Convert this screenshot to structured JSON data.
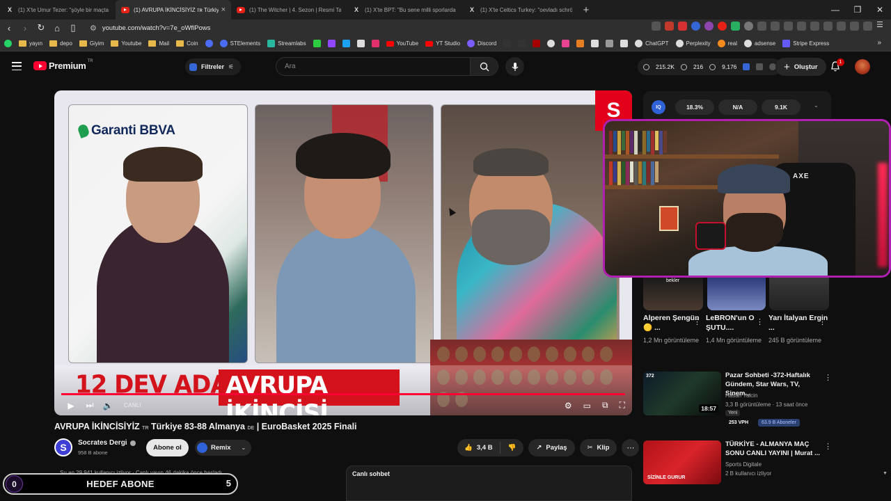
{
  "browser": {
    "tabs": [
      {
        "title": "(1) X'te Umur Tezer: \"şöyle bir maçta",
        "icon": "x-icon",
        "active": false
      },
      {
        "title": "(1) AVRUPA İKİNCİSİYİZ ᴛʀ Türkiye",
        "icon": "youtube-icon",
        "active": true
      },
      {
        "title": "(1) The Witcher | 4. Sezon | Resmi Tan",
        "icon": "youtube-icon",
        "active": false
      },
      {
        "title": "(1) X'te BPT: \"Bu sene milli sporlarda",
        "icon": "x-icon",
        "active": false
      },
      {
        "title": "(1) X'te Celtics Turkey: \"oevladı schrö",
        "icon": "x-icon",
        "active": false
      }
    ],
    "url": "youtube.com/watch?v=7e_oWflPows",
    "bookmarks": [
      {
        "label": "yayın",
        "icon": "folder"
      },
      {
        "label": "depo",
        "icon": "folder"
      },
      {
        "label": "Giyim",
        "icon": "folder"
      },
      {
        "label": "Youtube",
        "icon": "folder"
      },
      {
        "label": "Mail",
        "icon": "folder"
      },
      {
        "label": "Coin",
        "icon": "folder"
      },
      {
        "label": "STElements",
        "icon": "blue"
      },
      {
        "label": "Streamlabs",
        "icon": "teal"
      },
      {
        "label": "YouTube",
        "icon": "redyt"
      },
      {
        "label": "YT Studio",
        "icon": "redyt"
      },
      {
        "label": "Discord",
        "icon": "purple"
      },
      {
        "label": "ChatGPT",
        "icon": "white"
      },
      {
        "label": "Perplexity",
        "icon": "white"
      },
      {
        "label": "real",
        "icon": "orange"
      },
      {
        "label": "adsense",
        "icon": "white"
      },
      {
        "label": "Stripe Express",
        "icon": "stripe"
      }
    ],
    "more_bookmarks": "»"
  },
  "youtube": {
    "logo_text": "Premium",
    "logo_region": "TR",
    "filters_label": "Filtreler",
    "search_placeholder": "Ara",
    "stats": {
      "views": "215.2K",
      "likes": "216",
      "subs": "9,176"
    },
    "create_label": "Oluştur",
    "notification_count": "1"
  },
  "video": {
    "banner_part1": "12 DEV ADAM",
    "banner_part2": "AVRUPA İKİNCİSİ",
    "sponsor": "Garanti BBVA",
    "live_label": "CANLI",
    "title_a": "AVRUPA İKİNCİSİYİZ ",
    "title_tr": "TR",
    "title_b": " Türkiye 83-88 Almanya ",
    "title_de": "DE",
    "title_c": " | EuroBasket 2025 Finali",
    "channel": "Socrates Dergi",
    "subs": "958 B abone",
    "subscribe_label": "Abone ol",
    "remix_label": "Remix",
    "likes": "3,4 B",
    "share_label": "Paylaş",
    "clip_label": "Klip",
    "viewers": "Şu an 29.941 kullanıcı izliyor · Canlı yayın 46 dakika önce başladı",
    "chat_label": "Canlı sohbet"
  },
  "overlay": {
    "goal_current": "0",
    "goal_label": "HEDEF ABONE",
    "goal_target": "5"
  },
  "iq_panel": {
    "badge": "IQ",
    "values": [
      "18.3%",
      "N/A",
      "9.1K"
    ]
  },
  "shorts": [
    {
      "title": "Alperen Şengün 🟡 ...",
      "views": "1,2 Mn görüntüleme",
      "caption": "bekler"
    },
    {
      "title": "LeBRON'un O ŞUTU....",
      "views": "1,4 Mn görüntüleme"
    },
    {
      "title": "Yarı İtalyan Ergin ...",
      "views": "245 B görüntüleme"
    }
  ],
  "recommendations": [
    {
      "title": "Pazar Sohbeti -372-Haftalık Gündem, Star Wars, TV, Sinem...",
      "channel": "Hasan Yalcin",
      "meta": "3,3 B görüntüleme · 13 saat önce",
      "badge_new": "Yeni",
      "vph": "253 VPH",
      "subs_badge": "63.9 B Aboneler",
      "duration": "18:57",
      "thumb_label": "372"
    },
    {
      "title": "TÜRKİYE - ALMANYA MAÇ SONU CANLI YAYINI | Murat ...",
      "channel": "Sports Digitale",
      "meta": "2 B kullanıcı izliyor",
      "thumb_label": "SİZİNLE GURUR"
    }
  ],
  "webcam": {
    "chair_brand": "AXE"
  }
}
